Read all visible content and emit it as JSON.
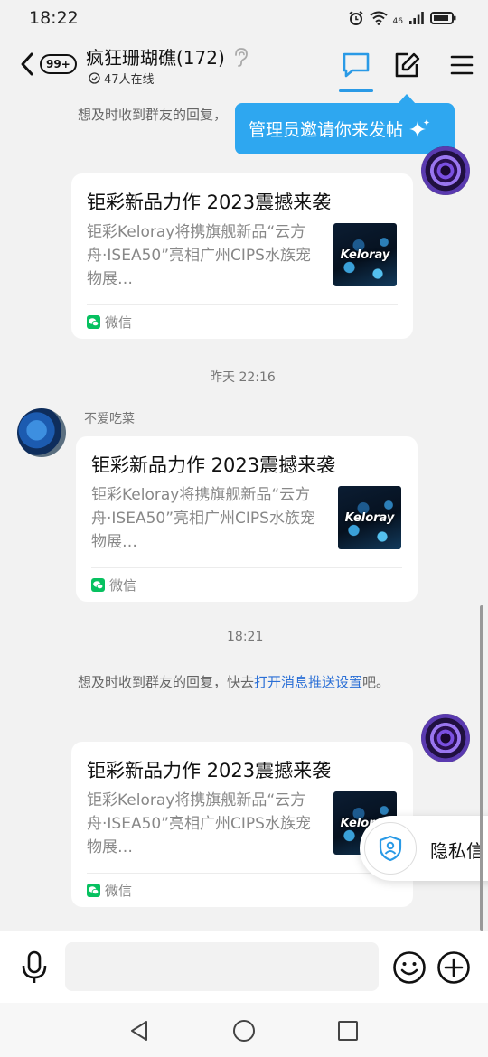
{
  "status_bar": {
    "time": "18:22",
    "network": "46"
  },
  "header": {
    "unread_badge": "99+",
    "title": "疯狂珊瑚礁(172)",
    "online": "47人在线"
  },
  "tooltip": {
    "text": "管理员邀请你来发帖"
  },
  "messages": {
    "sys_top": "想及时收到群友的回复，",
    "time_1": "昨天 22:16",
    "sender_2": "不爱吃菜",
    "time_2": "18:21",
    "sys_prefix": "想及时收到群友的回复，快去",
    "sys_link": "打开消息推送设置",
    "sys_suffix": "吧。"
  },
  "card": {
    "title": "钜彩新品力作 2023震撼来袭",
    "desc": "钜彩Keloray将携旗舰新品“云方舟·ISEA50”亮相广州CIPS水族宠物展…",
    "thumb_logo": "Keloray",
    "source": "微信"
  },
  "privacy": {
    "label": "隐私信"
  },
  "input": {
    "placeholder": ""
  },
  "colors": {
    "accent": "#2a9ae6",
    "tooltip": "#2ea7f0",
    "link": "#2a6fd6",
    "wechat": "#07c160"
  },
  "icons": {
    "back": "chevron-left-icon",
    "ear": "ear-icon",
    "chat": "chat-bubble-icon",
    "compose": "edit-icon",
    "menu": "menu-icon",
    "mic": "mic-icon",
    "emoji": "emoji-icon",
    "plus": "plus-icon",
    "privacy": "shield-user-icon",
    "sparkle": "sparkle-icon"
  }
}
